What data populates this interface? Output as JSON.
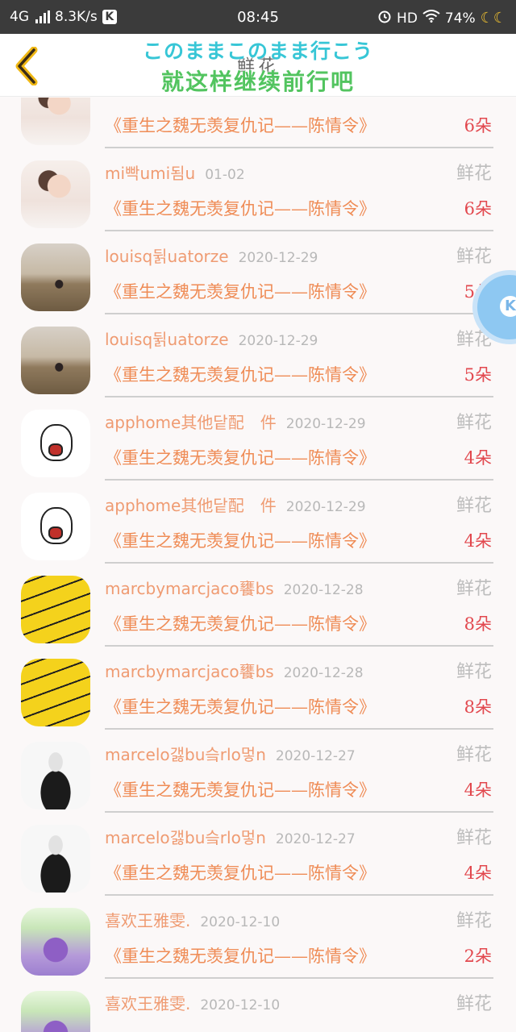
{
  "status_bar": {
    "network": "4G",
    "speed": "8.3K/s",
    "k_badge": "K",
    "time": "08:45",
    "hd": "HD",
    "battery": "74%",
    "moons": "☾☾"
  },
  "header": {
    "title": "鲜花",
    "overlay_jp": "このままこのまま行こう",
    "overlay_cn": "就这样继续前行吧"
  },
  "floating_button": {
    "label": "K"
  },
  "records": [
    {
      "avatar": "woman-white-dress",
      "name": "mi빡umi됨u",
      "date": "01-02",
      "type": "鲜花",
      "book": "《重生之魏无羡复仇记——陈情令》",
      "qty": "6朵"
    },
    {
      "avatar": "woman-white-dress",
      "name": "mi빡umi됨u",
      "date": "01-02",
      "type": "鲜花",
      "book": "《重生之魏无羡复仇记——陈情令》",
      "qty": "6朵"
    },
    {
      "avatar": "girl-in-field",
      "name": "louisq뒭uatorze",
      "date": "2020-12-29",
      "type": "鲜花",
      "book": "《重生之魏无羡复仇记——陈情令》",
      "qty": "5朵"
    },
    {
      "avatar": "girl-in-field",
      "name": "louisq뒭uatorze",
      "date": "2020-12-29",
      "type": "鲜花",
      "book": "《重生之魏无羡复仇记——陈情令》",
      "qty": "5朵"
    },
    {
      "avatar": "cartoon-face",
      "name": "apphome其他닽配　件",
      "date": "2020-12-29",
      "type": "鲜花",
      "book": "《重生之魏无羡复仇记——陈情令》",
      "qty": "4朵"
    },
    {
      "avatar": "cartoon-face",
      "name": "apphome其他닽配　件",
      "date": "2020-12-29",
      "type": "鲜花",
      "book": "《重生之魏无羡复仇记——陈情令》",
      "qty": "4朵"
    },
    {
      "avatar": "yellow-drawing",
      "name": "marcbymarcjaco饔bs",
      "date": "2020-12-28",
      "type": "鲜花",
      "book": "《重生之魏无羡复仇记——陈情令》",
      "qty": "8朵"
    },
    {
      "avatar": "yellow-drawing",
      "name": "marcbymarcjaco饔bs",
      "date": "2020-12-28",
      "type": "鲜花",
      "book": "《重生之魏无羡复仇记——陈情令》",
      "qty": "8朵"
    },
    {
      "avatar": "bw-portrait",
      "name": "marcelo갫bu슼rlo멓n",
      "date": "2020-12-27",
      "type": "鲜花",
      "book": "《重生之魏无羡复仇记——陈情令》",
      "qty": "4朵"
    },
    {
      "avatar": "bw-portrait",
      "name": "marcelo갫bu슼rlo멓n",
      "date": "2020-12-27",
      "type": "鲜花",
      "book": "《重生之魏无羡复仇记——陈情令》",
      "qty": "4朵"
    },
    {
      "avatar": "purple-drink",
      "name": "喜欢王雅雯.",
      "date": "2020-12-10",
      "type": "鲜花",
      "book": "《重生之魏无羡复仇记——陈情令》",
      "qty": "2朵"
    },
    {
      "avatar": "purple-drink",
      "name": "喜欢王雅雯.",
      "date": "2020-12-10",
      "type": "鲜花",
      "book": "",
      "qty": ""
    }
  ]
}
